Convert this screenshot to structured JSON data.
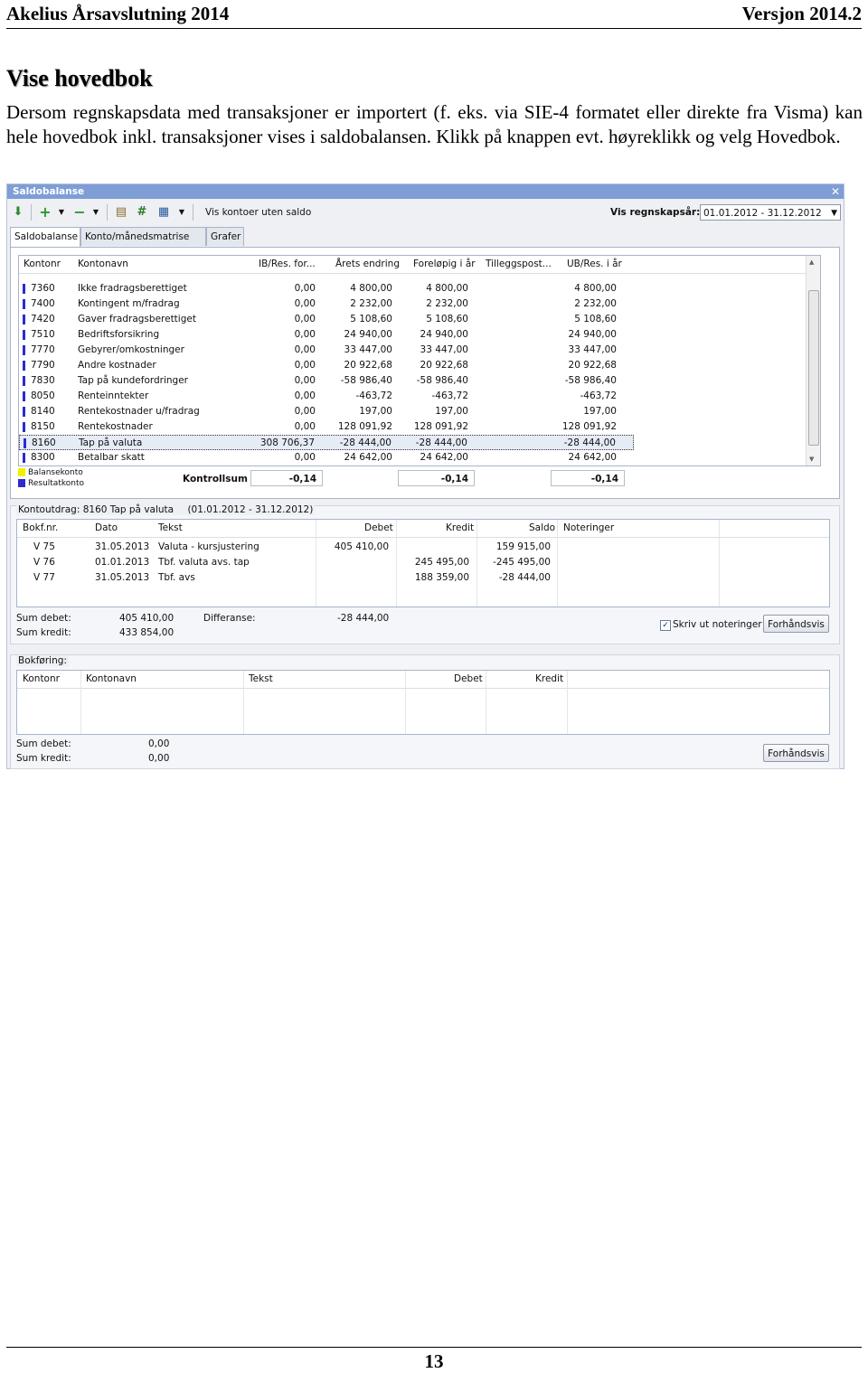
{
  "doc": {
    "header_left": "Akelius Årsavslutning 2014",
    "header_right": "Versjon 2014.2",
    "title": "Vise hovedbok",
    "intro": "Dersom regnskapsdata med transaksjoner er importert (f. eks. via SIE-4 formatet eller direkte fra Visma) kan hele hovedbok inkl. transaksjoner vises i saldobalansen. Klikk på knappen evt. høyreklikk og velg Hovedbok.",
    "page_number": "13"
  },
  "window": {
    "title": "Saldobalanse",
    "close": "✕",
    "toolbar": {
      "show_no_balance": "Vis kontoer uten saldo",
      "fiscal_year_label": "Vis regnskapsår:",
      "fiscal_year_value": "01.01.2012 - 31.12.2012"
    },
    "tabs": [
      "Saldobalanse",
      "Konto/månedsmatrise (tkr)",
      "Grafer"
    ],
    "balance_grid": {
      "headers": [
        "Kontonr",
        "Kontonavn",
        "IB/Res. for...",
        "Årets endring",
        "Foreløpig i år",
        "Tilleggspost...",
        "UB/Res. i år"
      ],
      "rows": [
        [
          "7360",
          "Ikke fradragsberettiget",
          "0,00",
          "4 800,00",
          "4 800,00",
          "",
          "4 800,00"
        ],
        [
          "7400",
          "Kontingent m/fradrag",
          "0,00",
          "2 232,00",
          "2 232,00",
          "",
          "2 232,00"
        ],
        [
          "7420",
          "Gaver fradragsberettiget",
          "0,00",
          "5 108,60",
          "5 108,60",
          "",
          "5 108,60"
        ],
        [
          "7510",
          "Bedriftsforsikring",
          "0,00",
          "24 940,00",
          "24 940,00",
          "",
          "24 940,00"
        ],
        [
          "7770",
          "Gebyrer/omkostninger",
          "0,00",
          "33 447,00",
          "33 447,00",
          "",
          "33 447,00"
        ],
        [
          "7790",
          "Andre kostnader",
          "0,00",
          "20 922,68",
          "20 922,68",
          "",
          "20 922,68"
        ],
        [
          "7830",
          "Tap på kundefordringer",
          "0,00",
          "-58 986,40",
          "-58 986,40",
          "",
          "-58 986,40"
        ],
        [
          "8050",
          "Renteinntekter",
          "0,00",
          "-463,72",
          "-463,72",
          "",
          "-463,72"
        ],
        [
          "8140",
          "Rentekostnader u/fradrag",
          "0,00",
          "197,00",
          "197,00",
          "",
          "197,00"
        ],
        [
          "8150",
          "Rentekostnader",
          "0,00",
          "128 091,92",
          "128 091,92",
          "",
          "128 091,92"
        ],
        [
          "8160",
          "Tap på valuta",
          "308 706,37",
          "-28 444,00",
          "-28 444,00",
          "",
          "-28 444,00"
        ],
        [
          "8300",
          "Betalbar skatt",
          "0,00",
          "24 642,00",
          "24 642,00",
          "",
          "24 642,00"
        ]
      ],
      "legend": [
        "Balansekonto",
        "Resultatkonto"
      ],
      "legend_colors": [
        "#f0f000",
        "#2b2bd0"
      ],
      "control_label": "Kontrollsum",
      "control_values": [
        "-0,14",
        "-0,14",
        "-0,14"
      ]
    },
    "extract": {
      "title": "Kontoutdrag: 8160 Tap på valuta",
      "period": "(01.01.2012 - 31.12.2012)",
      "headers": [
        "Bokf.nr.",
        "Dato",
        "Tekst",
        "Debet",
        "Kredit",
        "Saldo",
        "Noteringer"
      ],
      "rows": [
        [
          "V 75",
          "31.05.2013",
          "Valuta - kursjustering",
          "405 410,00",
          "",
          "159 915,00",
          ""
        ],
        [
          "V 76",
          "01.01.2013",
          "Tbf. valuta avs. tap",
          "",
          "245 495,00",
          "-245 495,00",
          ""
        ],
        [
          "V 77",
          "31.05.2013",
          "Tbf. avs",
          "",
          "188 359,00",
          "-28 444,00",
          ""
        ]
      ],
      "sum_debit_label": "Sum debet:",
      "sum_debit": "405 410,00",
      "sum_credit_label": "Sum kredit:",
      "sum_credit": "433 854,00",
      "diff_label": "Differanse:",
      "diff": "-28 444,00",
      "print_notes_label": "Skriv ut noteringer",
      "preview_label": "Forhåndsvis"
    },
    "posting": {
      "title": "Bokføring:",
      "headers": [
        "Kontonr",
        "Kontonavn",
        "Tekst",
        "Debet",
        "Kredit"
      ],
      "sum_debit_label": "Sum debet:",
      "sum_debit": "0,00",
      "sum_credit_label": "Sum kredit:",
      "sum_credit": "0,00",
      "preview_label": "Forhåndsvis"
    }
  }
}
